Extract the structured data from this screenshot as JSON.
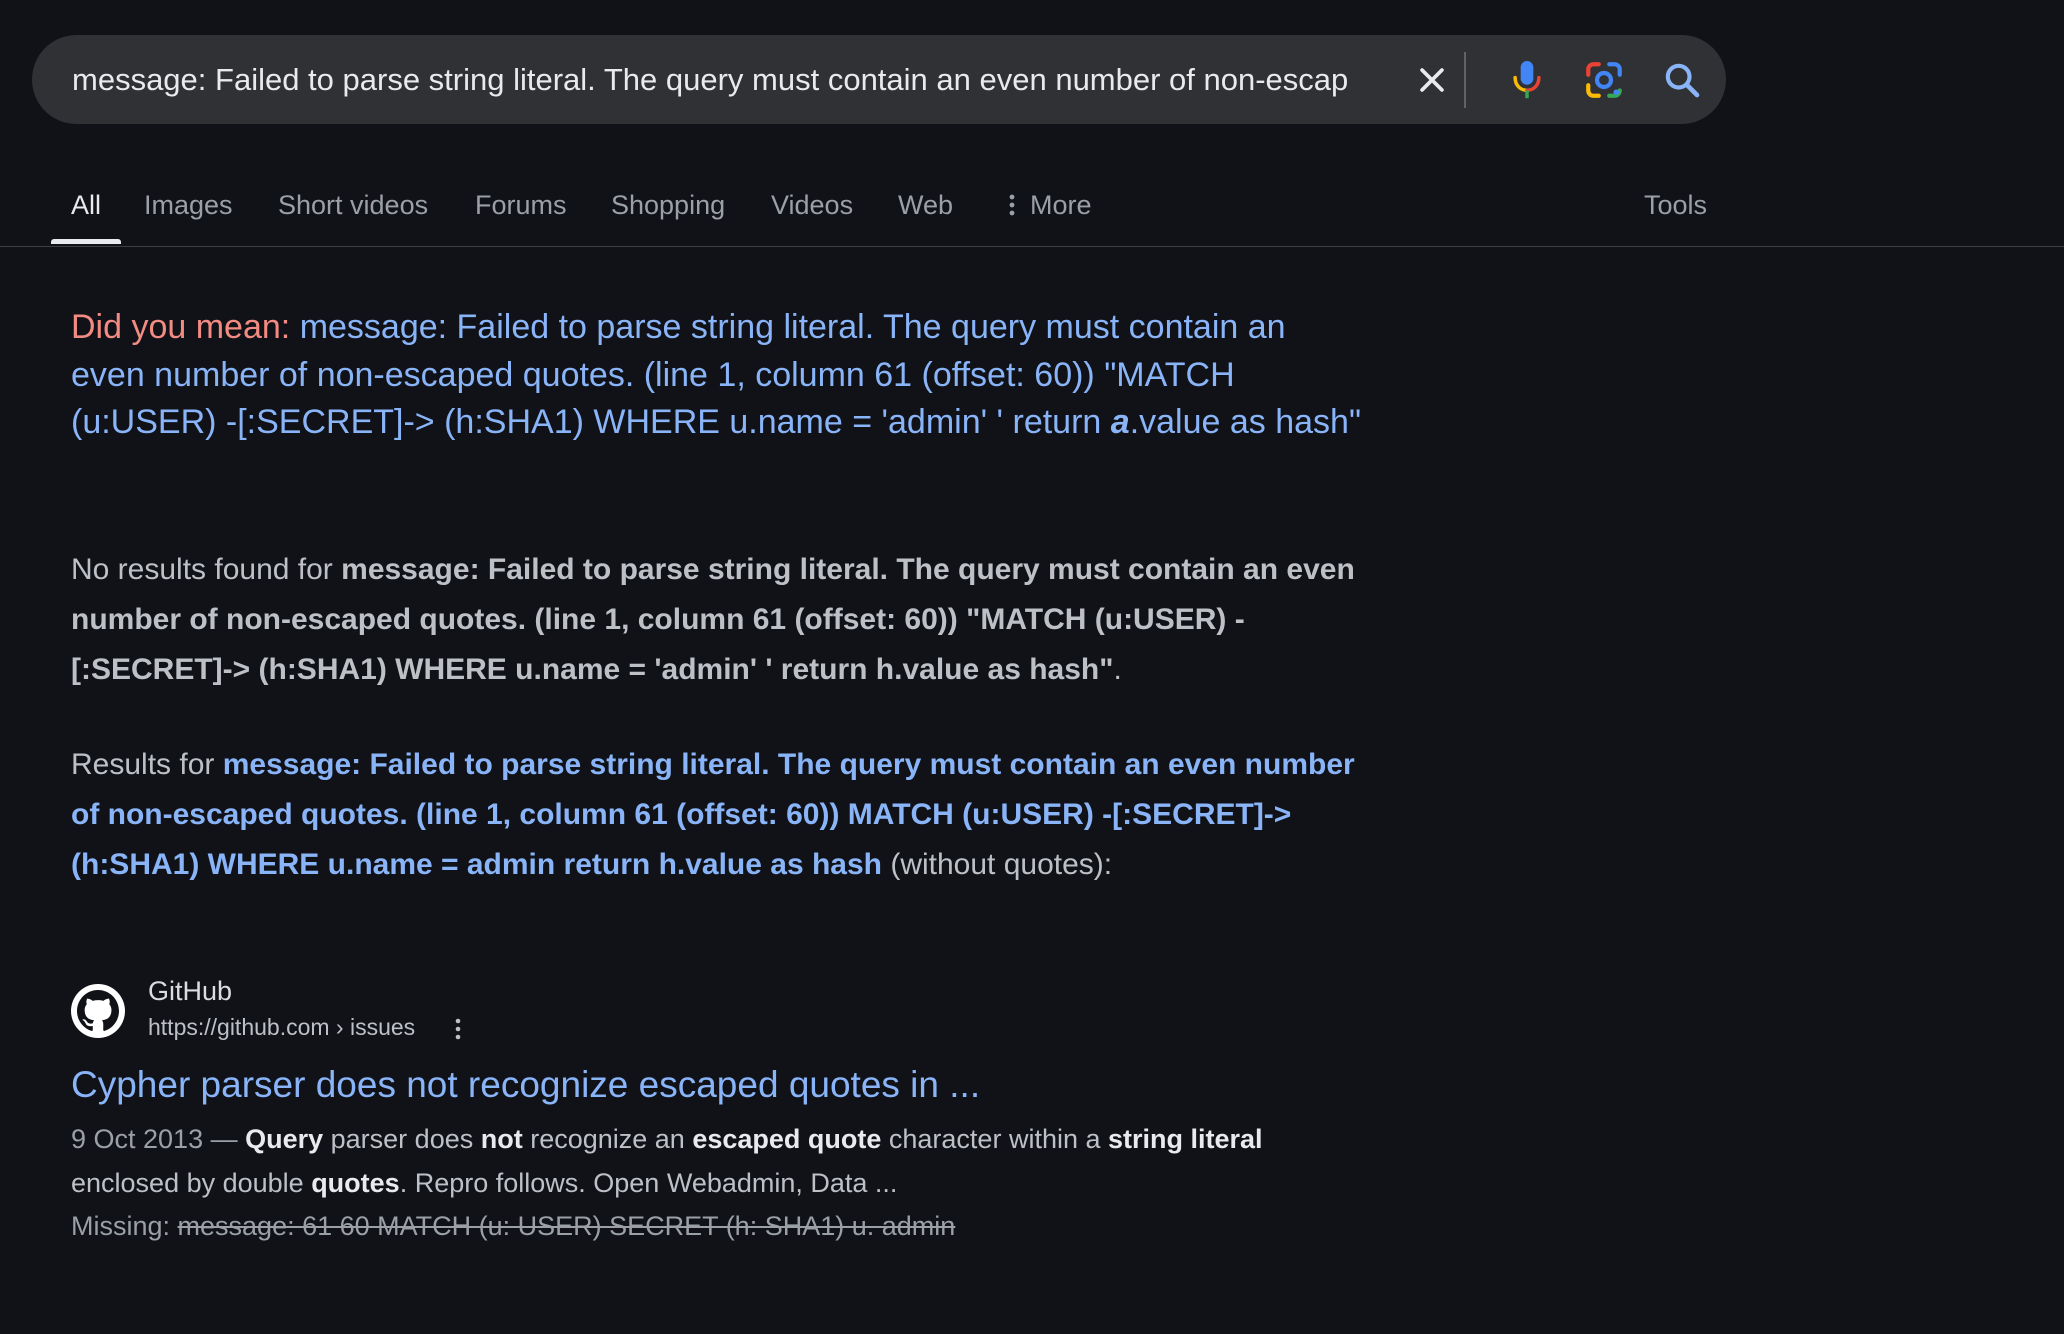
{
  "search": {
    "query": "message: Failed to parse string literal. The query must contain an even number of non-escap",
    "icons": {
      "clear": "close-icon",
      "voice": "microphone-icon",
      "lens": "google-lens-icon",
      "search": "search-icon"
    }
  },
  "tabs": [
    {
      "label": "All",
      "active": true
    },
    {
      "label": "Images"
    },
    {
      "label": "Short videos"
    },
    {
      "label": "Forums"
    },
    {
      "label": "Shopping"
    },
    {
      "label": "Videos"
    },
    {
      "label": "Web"
    },
    {
      "label": "More",
      "icon": "more-vert-icon"
    }
  ],
  "tools_label": "Tools",
  "did_you_mean": {
    "label": "Did you mean:",
    "suggestion_before": "message: Failed to parse string literal. The query must contain an even number of non-escaped quotes. (line 1, column 61 (offset: 60)) \"MATCH (u:USER) -[:SECRET]-> (h:SHA1) WHERE u.name = 'admin' ' return ",
    "suggestion_emphasis": "a",
    "suggestion_after": ".value as hash\""
  },
  "no_results": {
    "prefix": "No results found for ",
    "query": "message: Failed to parse string literal. The query must contain an even number of non-escaped quotes. (line 1, column 61 (offset: 60)) \"MATCH (u:USER) -[:SECRET]-> (h:SHA1) WHERE u.name = 'admin' ' return h.value as hash\"",
    "suffix": "."
  },
  "results_for": {
    "prefix": "Results for ",
    "query": "message: Failed to parse string literal. The query must contain an even number of non-escaped quotes. (line 1, column 61 (offset: 60)) MATCH (u:USER) -[:SECRET]-> (h:SHA1) WHERE u.name = admin return h.value as hash",
    "suffix": " (without quotes):"
  },
  "result": {
    "site_name": "GitHub",
    "site_url": "https://github.com › issues",
    "favicon": "github-icon",
    "title": "Cypher parser does not recognize escaped quotes in ...",
    "snippet": {
      "date": "9 Oct 2013 — ",
      "parts": [
        {
          "t": "Query",
          "b": true
        },
        {
          "t": " parser does "
        },
        {
          "t": "not",
          "b": true
        },
        {
          "t": " recognize an "
        },
        {
          "t": "escaped quote",
          "b": true
        },
        {
          "t": " character within a "
        },
        {
          "t": "string literal",
          "b": true
        },
        {
          "t": " enclosed by double "
        },
        {
          "t": "quotes",
          "b": true
        },
        {
          "t": ". Repro follows. Open Webadmin, Data ..."
        }
      ]
    },
    "missing_label": "Missing: ",
    "missing_terms": "message: 61 60 MATCH (u: USER) SECRET (h: SHA1) u. admin"
  }
}
